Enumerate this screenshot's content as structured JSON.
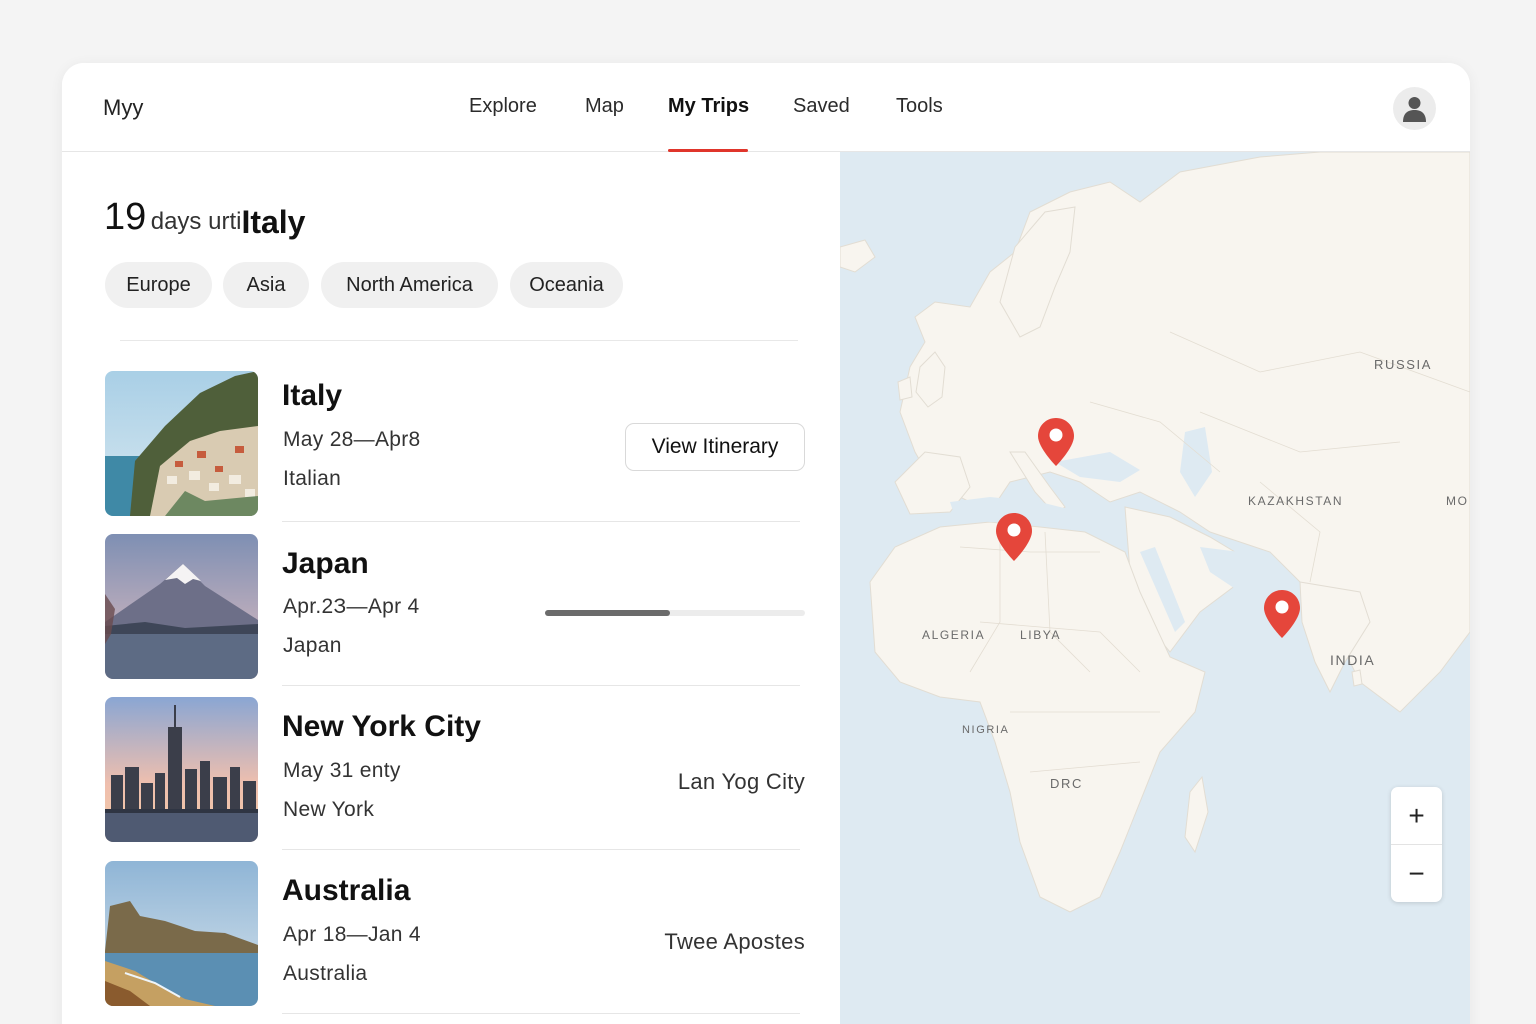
{
  "app": {
    "brand": "Myy"
  },
  "nav": {
    "items": [
      {
        "label": "Explore"
      },
      {
        "label": "Map"
      },
      {
        "label": "My Trips",
        "active": true
      },
      {
        "label": "Saved"
      },
      {
        "label": "Tools"
      }
    ]
  },
  "countdown": {
    "number": "19",
    "middle": "days urti",
    "destination": "Italy"
  },
  "regions": [
    "Europe",
    "Asia",
    "North America",
    "Oceania"
  ],
  "trips": [
    {
      "title": "Italy",
      "dates": "May 28—Aþr8",
      "subtitle": "Italian",
      "action_label": "View Itinerary"
    },
    {
      "title": "Japan",
      "dates": "Apr.2З—Apr 4",
      "subtitle": "Japan",
      "progress": 0.48
    },
    {
      "title": "New York City",
      "dates": "May 31 enty",
      "subtitle": "New York",
      "right_text": "Lan Yog City"
    },
    {
      "title": "Australia",
      "dates": "Apr 18—Jan 4",
      "subtitle": "Australia",
      "right_text": "Twee Apostes"
    }
  ],
  "map": {
    "labels": [
      "RUSSIA",
      "KAZAKHSTAN",
      "MO",
      "ALGERIA",
      "LIBYA",
      "NIGRIA",
      "DRC",
      "INDIA"
    ],
    "zoom_in": "+",
    "zoom_out": "−",
    "colors": {
      "water": "#deeaf2",
      "land": "#f8f5ef",
      "pin": "#e5463b"
    }
  },
  "colors": {
    "accent": "#e0352b"
  },
  "icons": {
    "avatar": "user-icon",
    "pin": "map-pin-icon"
  }
}
